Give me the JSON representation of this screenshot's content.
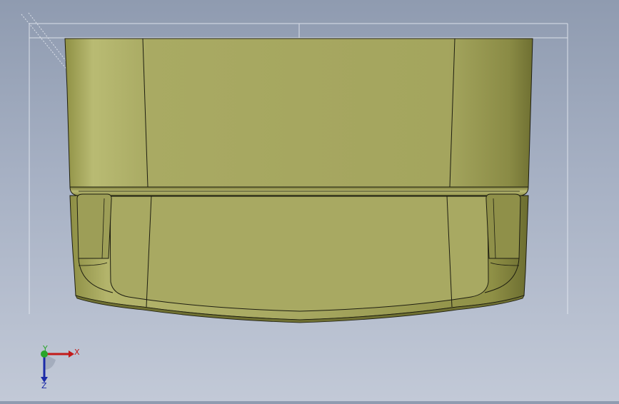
{
  "viewport": {
    "background_top": "#8f9bb0",
    "background_bottom": "#c2c9d7",
    "model_color": "#a4a55f",
    "model_color_dark": "#7e7f3c",
    "edge_color": "#1d1d10"
  },
  "triad": {
    "x_label": "X",
    "y_label": "Y",
    "z_label": "Z",
    "x_color": "#c21a1a",
    "y_color": "#2aa52a",
    "z_color": "#1b2aa8"
  }
}
